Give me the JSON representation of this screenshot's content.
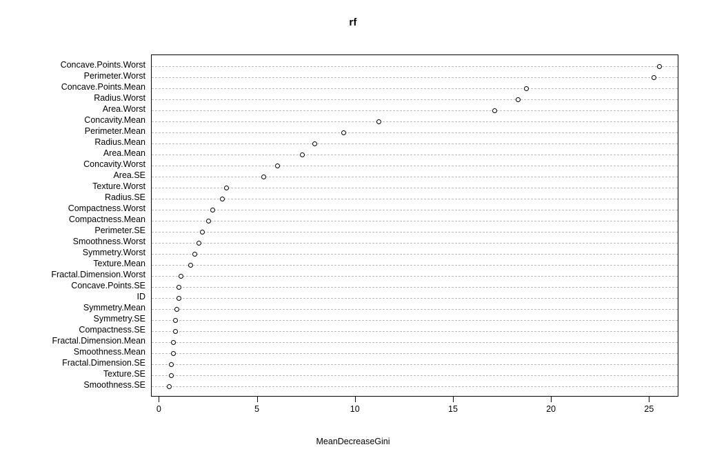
{
  "chart_data": {
    "type": "scatter",
    "title": "rf",
    "xlabel": "MeanDecreaseGini",
    "ylabel": "",
    "grid": true,
    "legend": null,
    "xlim": [
      -0.4,
      26.5
    ],
    "xticks": [
      0,
      5,
      10,
      15,
      20,
      25
    ],
    "xtick_labels": [
      "0",
      "5",
      "10",
      "15",
      "20",
      "25"
    ],
    "categories": [
      "Concave.Points.Worst",
      "Perimeter.Worst",
      "Concave.Points.Mean",
      "Radius.Worst",
      "Area.Worst",
      "Concavity.Mean",
      "Perimeter.Mean",
      "Radius.Mean",
      "Area.Mean",
      "Concavity.Worst",
      "Area.SE",
      "Texture.Worst",
      "Radius.SE",
      "Compactness.Worst",
      "Compactness.Mean",
      "Perimeter.SE",
      "Smoothness.Worst",
      "Symmetry.Worst",
      "Texture.Mean",
      "Fractal.Dimension.Worst",
      "Concave.Points.SE",
      "ID",
      "Symmetry.Mean",
      "Symmetry.SE",
      "Compactness.SE",
      "Fractal.Dimension.Mean",
      "Smoothness.Mean",
      "Fractal.Dimension.SE",
      "Texture.SE",
      "Smoothness.SE"
    ],
    "values": [
      25.5,
      25.2,
      18.7,
      18.3,
      17.1,
      11.2,
      9.4,
      7.9,
      7.3,
      6.0,
      5.3,
      3.4,
      3.2,
      2.7,
      2.5,
      2.2,
      2.0,
      1.8,
      1.6,
      1.1,
      1.0,
      1.0,
      0.9,
      0.8,
      0.8,
      0.7,
      0.7,
      0.6,
      0.6,
      0.5
    ]
  },
  "axis": {
    "x_title": "MeanDecreaseGini"
  },
  "title": {
    "text": "rf"
  }
}
